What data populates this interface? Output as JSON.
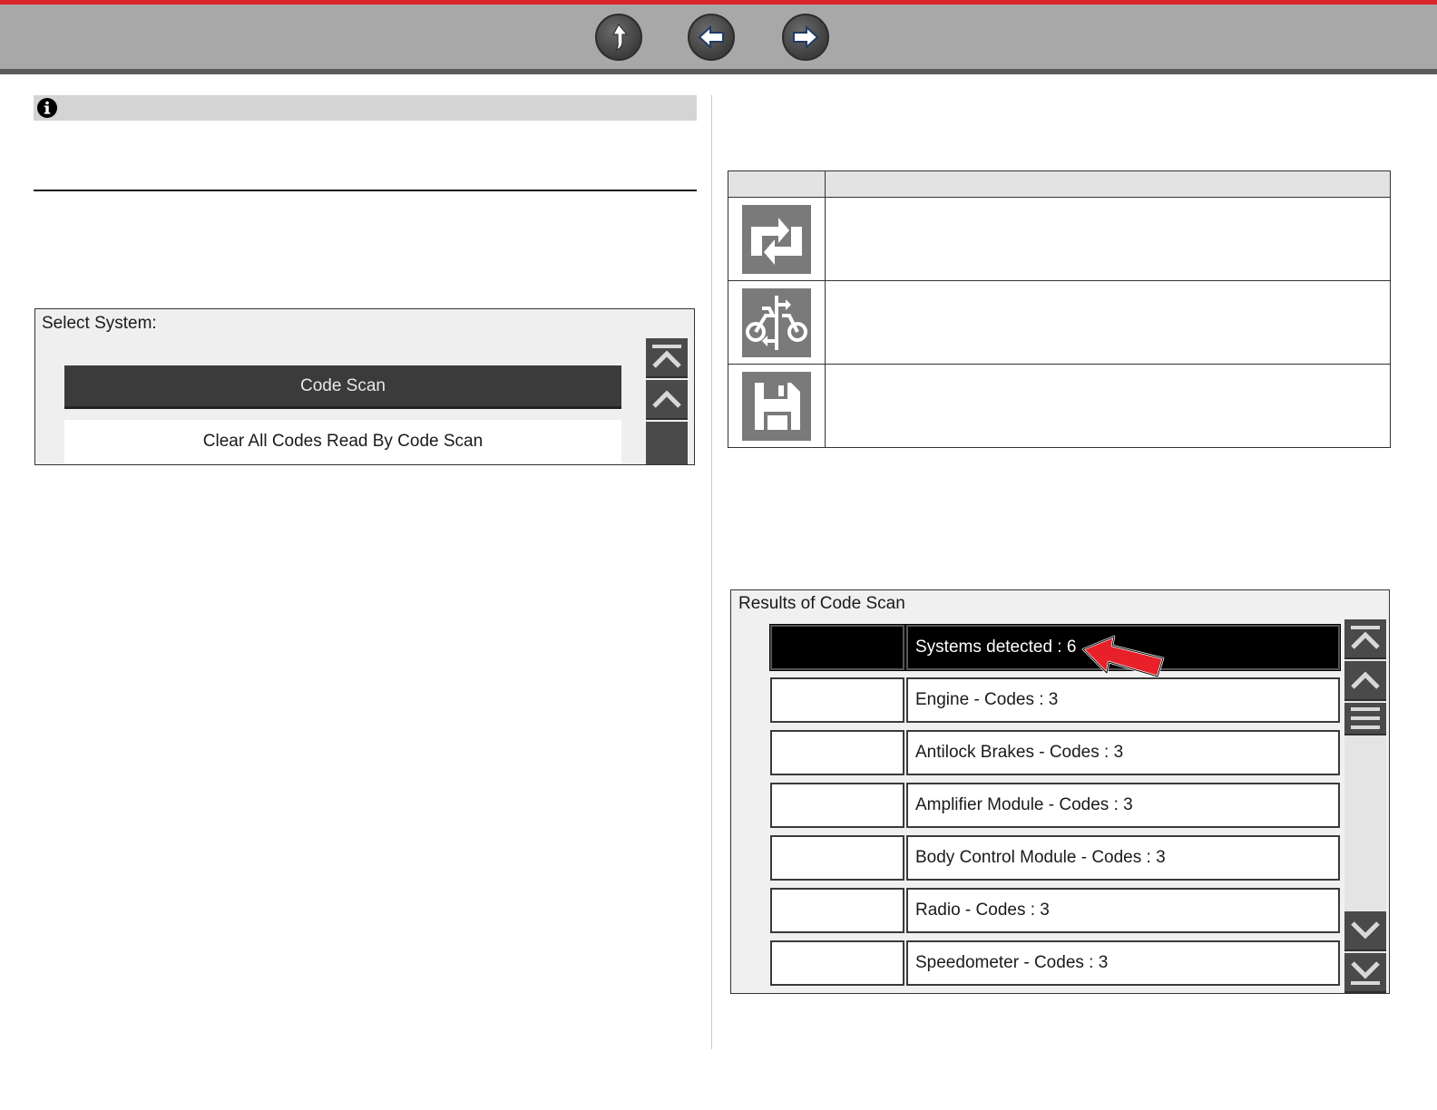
{
  "nav": {
    "buttons": [
      "home-icon",
      "back-icon",
      "forward-icon"
    ]
  },
  "select_panel": {
    "title": "Select System:",
    "items": [
      "Code Scan",
      "Clear All Codes Read By Code Scan"
    ],
    "selected_index": 0
  },
  "icon_table": {
    "rows": [
      "swap-icon",
      "vehicle-systems-icon",
      "save-icon"
    ]
  },
  "results_panel": {
    "title": "Results of Code Scan",
    "rows": [
      "Systems detected : 6",
      "Engine - Codes : 3",
      "Antilock Brakes - Codes : 3",
      "Amplifier Module - Codes : 3",
      "Body Control Module - Codes : 3",
      "Radio - Codes : 3",
      "Speedometer - Codes : 3"
    ],
    "selected_index": 0
  },
  "colors": {
    "top_accent": "#d9252c",
    "toolbar": "#a8a8a8",
    "selected_row": "#000000",
    "callout_arrow": "#e8202a"
  }
}
